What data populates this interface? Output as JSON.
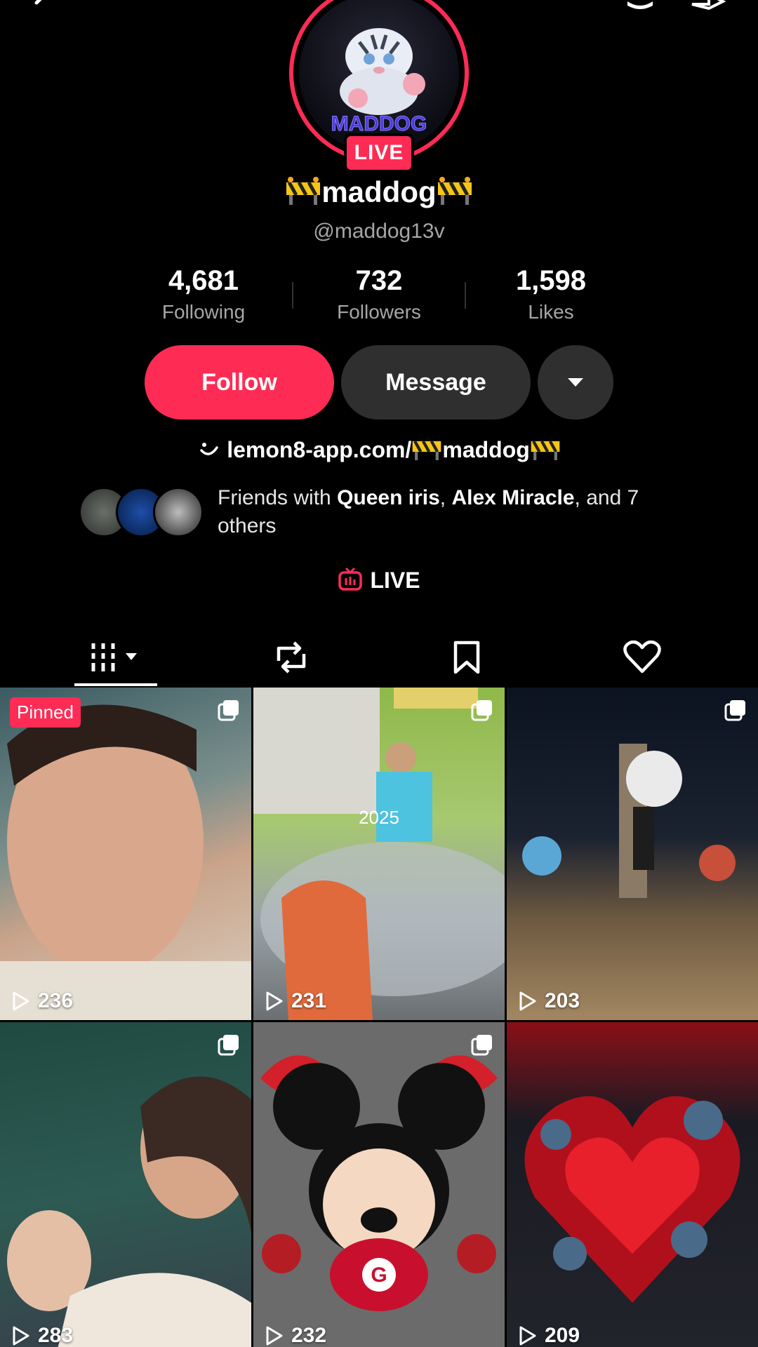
{
  "profile": {
    "live_badge": "LIVE",
    "display_name": "maddog",
    "handle": "@maddog13v"
  },
  "stats": [
    {
      "value": "4,681",
      "label": "Following"
    },
    {
      "value": "732",
      "label": "Followers"
    },
    {
      "value": "1,598",
      "label": "Likes"
    }
  ],
  "actions": {
    "follow_label": "Follow",
    "message_label": "Message"
  },
  "bio": {
    "link_prefix": "lemon8-app.com/",
    "link_name": "maddog"
  },
  "friends": {
    "prefix": "Friends with ",
    "name1": "Queen iris",
    "sep": ", ",
    "name2": "Alex Miracle",
    "suffix": ", and 7 others"
  },
  "live_section": {
    "label": "LIVE"
  },
  "tabs": [
    "videos-icon",
    "repost-icon",
    "bookmark-icon",
    "liked-icon"
  ],
  "videos": [
    {
      "views": "236",
      "pinned": "Pinned",
      "overlay": ""
    },
    {
      "views": "231",
      "pinned": "",
      "overlay": "2025"
    },
    {
      "views": "203",
      "pinned": "",
      "overlay": ""
    },
    {
      "views": "283",
      "pinned": "",
      "overlay": ""
    },
    {
      "views": "232",
      "pinned": "",
      "overlay": ""
    },
    {
      "views": "209",
      "pinned": "",
      "overlay": ""
    }
  ],
  "colors": {
    "accent": "#fe2c55",
    "bg": "#000000",
    "secondary_text": "#a6a6a6"
  }
}
